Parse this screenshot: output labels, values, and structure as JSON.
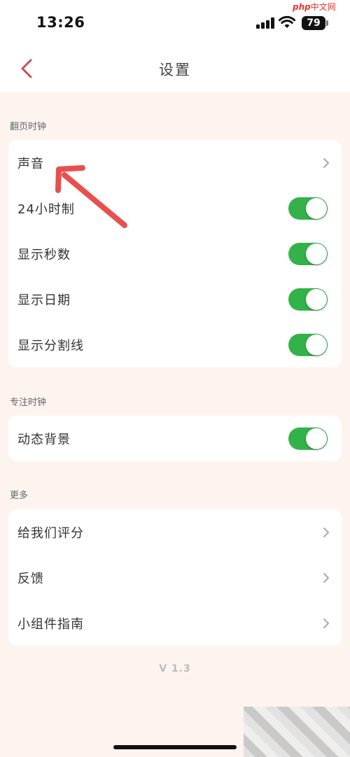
{
  "status_bar": {
    "time": "13:26",
    "battery": "79",
    "watermark_prefix": "php",
    "watermark_text": "中文网"
  },
  "nav": {
    "title": "设置"
  },
  "sections": {
    "flip_clock": {
      "header": "翻页时钟",
      "rows": [
        {
          "label": "声音",
          "type": "chevron"
        },
        {
          "label": "24小时制",
          "type": "toggle",
          "on": true
        },
        {
          "label": "显示秒数",
          "type": "toggle",
          "on": true
        },
        {
          "label": "显示日期",
          "type": "toggle",
          "on": true
        },
        {
          "label": "显示分割线",
          "type": "toggle",
          "on": true
        }
      ]
    },
    "focus_clock": {
      "header": "专注时钟",
      "rows": [
        {
          "label": "动态背景",
          "type": "toggle",
          "on": true
        }
      ]
    },
    "more": {
      "header": "更多",
      "rows": [
        {
          "label": "给我们评分",
          "type": "chevron"
        },
        {
          "label": "反馈",
          "type": "chevron"
        },
        {
          "label": "小组件指南",
          "type": "chevron"
        }
      ]
    }
  },
  "version": "V 1.3",
  "colors": {
    "toggle_on": "#34b24a",
    "accent": "#c0505a",
    "background": "#fdf4f0",
    "annotation_arrow": "#e8504f"
  }
}
